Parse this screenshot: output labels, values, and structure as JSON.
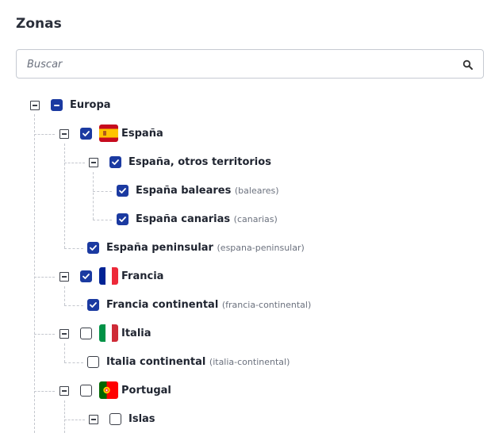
{
  "header": {
    "title": "Zonas"
  },
  "search": {
    "placeholder": "Buscar",
    "value": "",
    "icon": "search-icon"
  },
  "colors": {
    "accent": "#1b3aa1",
    "border": "#c6cad2",
    "guide": "#c4c7ce"
  },
  "tree": {
    "europa": {
      "label": "Europa",
      "state": "indeterminate",
      "expanded": true
    },
    "espana": {
      "label": "España",
      "state": "checked",
      "expanded": true,
      "flag": "flag-spain"
    },
    "espana_otros": {
      "label": "España, otros territorios",
      "state": "checked",
      "expanded": true
    },
    "espana_baleares": {
      "label": "España baleares",
      "code": "(baleares)",
      "state": "checked"
    },
    "espana_canarias": {
      "label": "España canarias",
      "code": "(canarias)",
      "state": "checked"
    },
    "espana_peninsular": {
      "label": "España peninsular",
      "code": "(espana-peninsular)",
      "state": "checked"
    },
    "francia": {
      "label": "Francia",
      "state": "checked",
      "expanded": true,
      "flag": "flag-france"
    },
    "francia_continental": {
      "label": "Francia continental",
      "code": "(francia-continental)",
      "state": "checked"
    },
    "italia": {
      "label": "Italia",
      "state": "unchecked",
      "expanded": true,
      "flag": "flag-italy"
    },
    "italia_continental": {
      "label": "Italia continental",
      "code": "(italia-continental)",
      "state": "unchecked"
    },
    "portugal": {
      "label": "Portugal",
      "state": "unchecked",
      "expanded": true,
      "flag": "flag-portugal"
    },
    "islas": {
      "label": "Islas",
      "state": "unchecked",
      "expanded": true
    }
  }
}
